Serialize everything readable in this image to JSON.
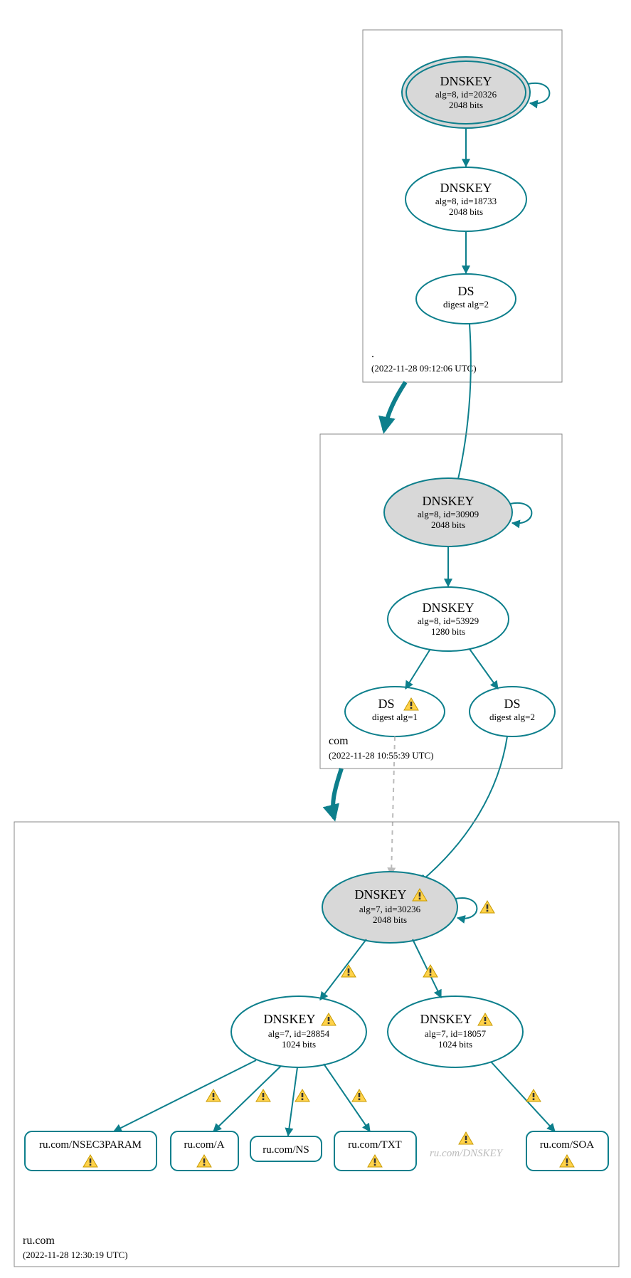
{
  "colors": {
    "teal": "#0d7f8c",
    "grey_fill": "#d8d8d8",
    "muted": "#bbbbbb"
  },
  "zones": {
    "root": {
      "name": ".",
      "timestamp": "(2022-11-28 09:12:06 UTC)",
      "nodes": {
        "ksk": {
          "title": "DNSKEY",
          "sub1": "alg=8, id=20326",
          "sub2": "2048 bits"
        },
        "zsk": {
          "title": "DNSKEY",
          "sub1": "alg=8, id=18733",
          "sub2": "2048 bits"
        },
        "ds": {
          "title": "DS",
          "sub1": "digest alg=2"
        }
      }
    },
    "com": {
      "name": "com",
      "timestamp": "(2022-11-28 10:55:39 UTC)",
      "nodes": {
        "ksk": {
          "title": "DNSKEY",
          "sub1": "alg=8, id=30909",
          "sub2": "2048 bits"
        },
        "zsk": {
          "title": "DNSKEY",
          "sub1": "alg=8, id=53929",
          "sub2": "1280 bits"
        },
        "ds1": {
          "title": "DS",
          "sub1": "digest alg=1",
          "warn": true
        },
        "ds2": {
          "title": "DS",
          "sub1": "digest alg=2"
        }
      }
    },
    "rucom": {
      "name": "ru.com",
      "timestamp": "(2022-11-28 12:30:19 UTC)",
      "nodes": {
        "ksk": {
          "title": "DNSKEY",
          "sub1": "alg=7, id=30236",
          "sub2": "2048 bits",
          "warn": true
        },
        "zsk_l": {
          "title": "DNSKEY",
          "sub1": "alg=7, id=28854",
          "sub2": "1024 bits",
          "warn": true
        },
        "zsk_r": {
          "title": "DNSKEY",
          "sub1": "alg=7, id=18057",
          "sub2": "1024 bits",
          "warn": true
        }
      },
      "rrsets": {
        "nsec3param": {
          "label": "ru.com/NSEC3PARAM",
          "warn": true
        },
        "a": {
          "label": "ru.com/A",
          "warn": true
        },
        "ns": {
          "label": "ru.com/NS",
          "warn": false
        },
        "txt": {
          "label": "ru.com/TXT",
          "warn": true
        },
        "dnskey": {
          "label": "ru.com/DNSKEY",
          "warn": true,
          "muted": true
        },
        "soa": {
          "label": "ru.com/SOA",
          "warn": true
        }
      }
    }
  }
}
